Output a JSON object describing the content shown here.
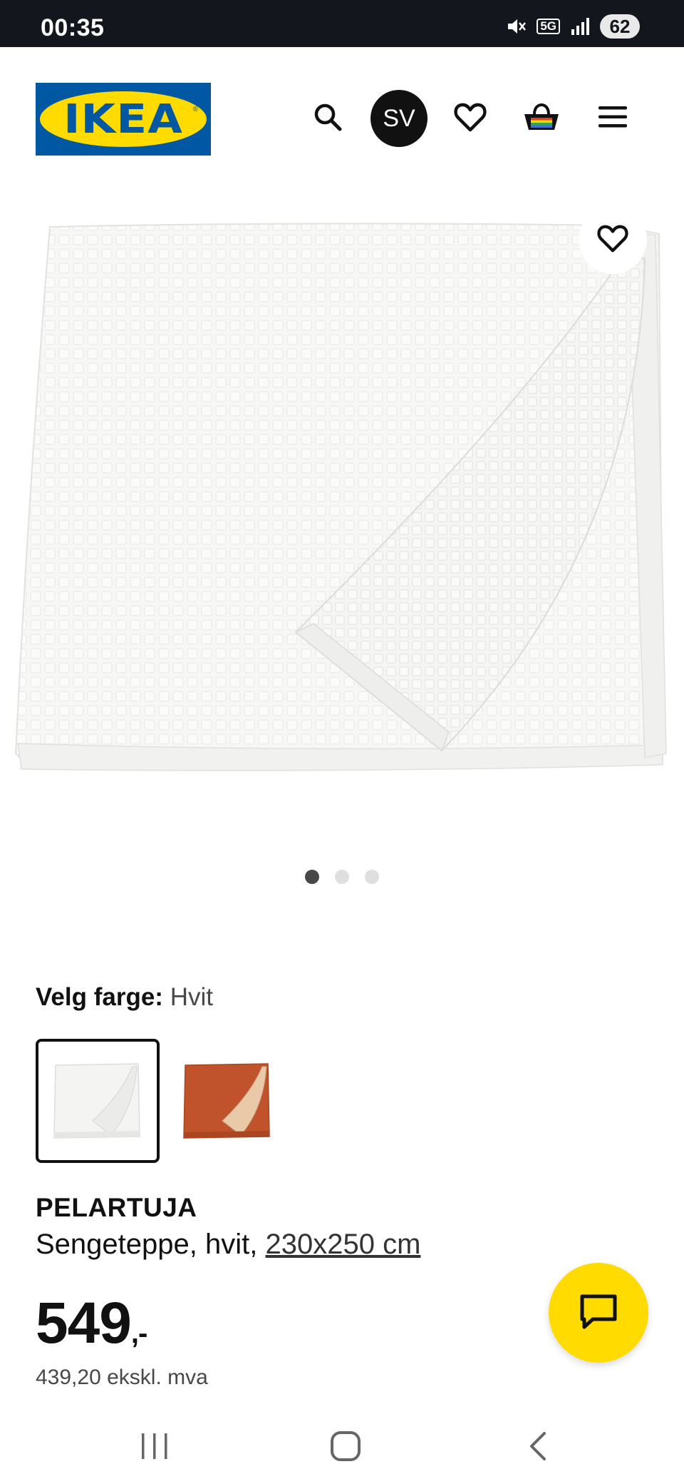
{
  "status_bar": {
    "time": "00:35",
    "network": "5G",
    "battery": "62"
  },
  "header": {
    "logo_text": "IKEA",
    "logo_reg": "®",
    "avatar_initials": "SV",
    "icons": [
      "search-icon",
      "heart-icon",
      "basket-icon",
      "menu-icon"
    ]
  },
  "gallery": {
    "image_count": 3,
    "active_index": 0
  },
  "color_selector": {
    "label": "Velg farge:",
    "selected_value": "Hvit",
    "options": [
      "white",
      "orange"
    ]
  },
  "product": {
    "name": "PELARTUJA",
    "description": "Sengeteppe, hvit,",
    "size": "230x250 cm",
    "price_main": "549",
    "price_suffix": ",-",
    "price_ex_vat": "439,20 ekskl. mva"
  },
  "colors": {
    "brand_blue": "#0058a3",
    "brand_yellow": "#ffdb00",
    "status_bar_bg": "#14161e",
    "swatch_orange": "#c0532b"
  }
}
